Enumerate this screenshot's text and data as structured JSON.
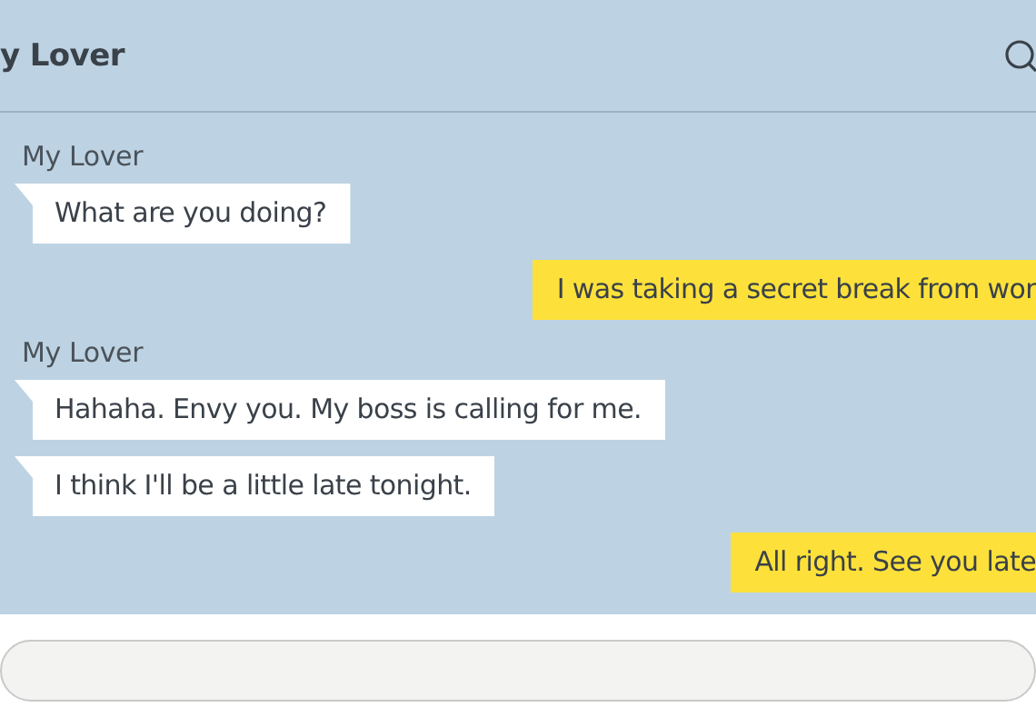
{
  "header": {
    "title": "y Lover"
  },
  "messages": [
    {
      "kind": "incoming",
      "sender": "My Lover",
      "text": "What are you doing?"
    },
    {
      "kind": "outgoing",
      "text": "I was taking a secret break from wor"
    },
    {
      "kind": "incoming",
      "sender": "My Lover",
      "text": "Hahaha. Envy you. My boss is calling for me."
    },
    {
      "kind": "incoming",
      "text": "I think I'll be a little late tonight."
    },
    {
      "kind": "outgoing",
      "text": "All right. See you late"
    }
  ]
}
